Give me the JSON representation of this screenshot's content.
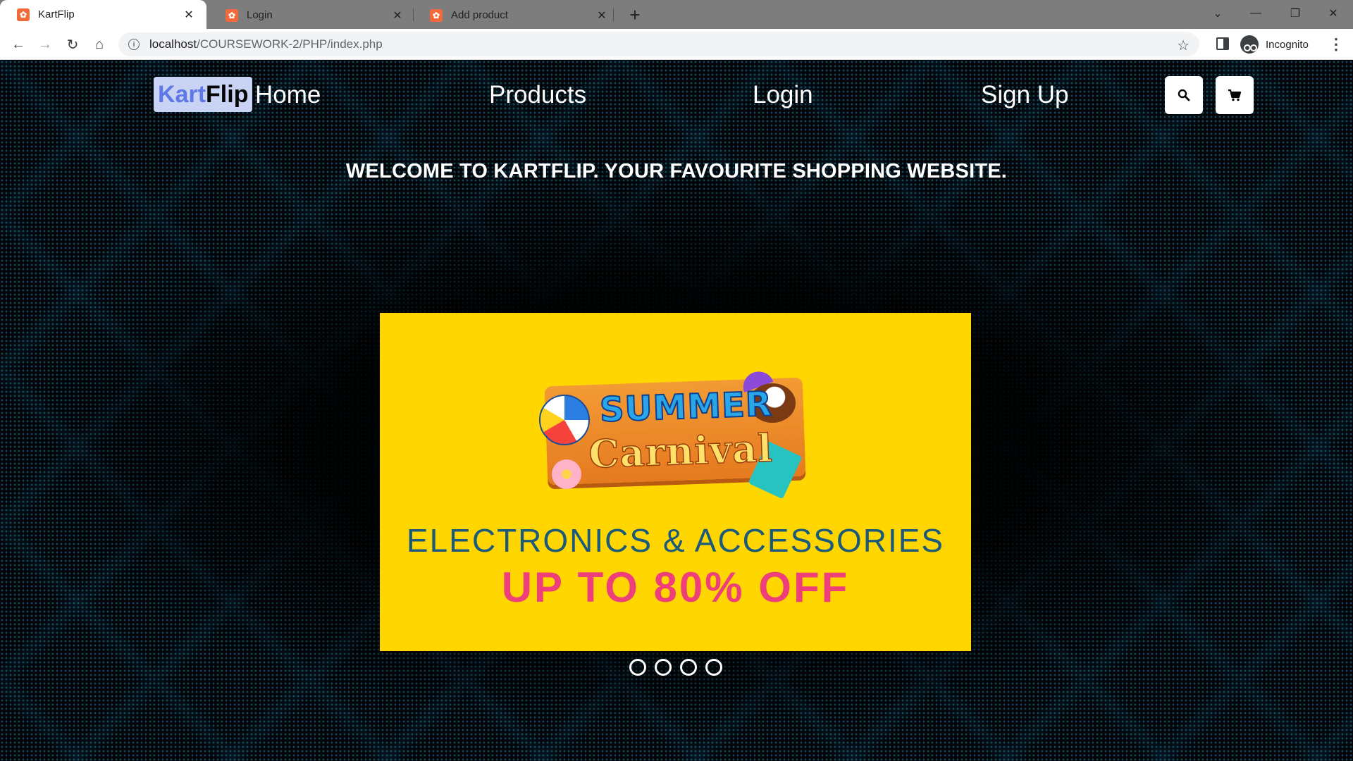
{
  "browser": {
    "tabs": [
      {
        "title": "KartFlip",
        "active": true
      },
      {
        "title": "Login",
        "active": false
      },
      {
        "title": "Add product",
        "active": false
      }
    ],
    "url_host": "localhost",
    "url_path": "/COURSEWORK-2/PHP/index.php",
    "profile_label": "Incognito"
  },
  "site": {
    "brand_part1": "Kart",
    "brand_part2": "Flip",
    "nav": {
      "home": "Home",
      "products": "Products",
      "login": "Login",
      "signup": "Sign Up"
    },
    "welcome": "WELCOME TO KARTFLIP. YOUR FAVOURITE SHOPPING WEBSITE.",
    "banner": {
      "sign_line1": "SUMMER",
      "sign_line2": "Carnival",
      "line1": "ELECTRONICS & ACCESSORIES",
      "line2": "UP TO 80% OFF"
    },
    "carousel_slide_count": 4
  },
  "colors": {
    "brand_kart": "#6077e6",
    "brand_bg": "#c9d3f4",
    "banner_bg": "#ffd600",
    "promo_pink": "#ee3f7a",
    "promo_teal": "#1b5a7a"
  },
  "icons": {
    "search": "search-icon",
    "cart": "cart-icon"
  }
}
